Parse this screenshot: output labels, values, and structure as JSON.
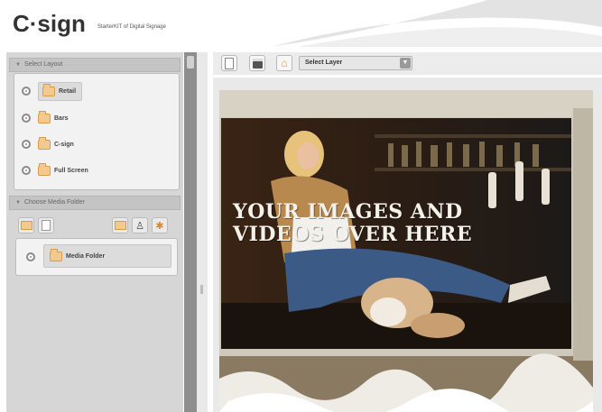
{
  "header": {
    "logo_text": "C·sign",
    "tagline": "StarterKIT of Digital Signage"
  },
  "left_panel": {
    "select_layout_title": "Select Layout",
    "layouts": [
      {
        "label": "Retail",
        "selected": true
      },
      {
        "label": "Bars",
        "selected": false
      },
      {
        "label": "C-sign",
        "selected": false
      },
      {
        "label": "Full Screen",
        "selected": false
      }
    ],
    "media_section_title": "Choose Media Folder",
    "media_folders": [
      {
        "label": "Media Folder",
        "selected": true
      }
    ]
  },
  "toolbar": {
    "layer_select_value": "Select Layer"
  },
  "canvas": {
    "overlay_line1": "YOUR IMAGES AND",
    "overlay_line2": "VIDEOS OVER HERE"
  },
  "colors": {
    "panel_bg": "#d6d6d6",
    "scrollbar": "#8e8e8e",
    "folder": "#f3c98d",
    "canvas_frame": "#cfc9bb"
  },
  "icons": {
    "toolbar": [
      "clipboard-icon",
      "save-icon",
      "home-icon",
      "dropdown-arrow-icon"
    ],
    "media_buttons": [
      "folder-open-icon",
      "document-icon",
      "image-icon",
      "person-icon",
      "settings-icon"
    ]
  }
}
